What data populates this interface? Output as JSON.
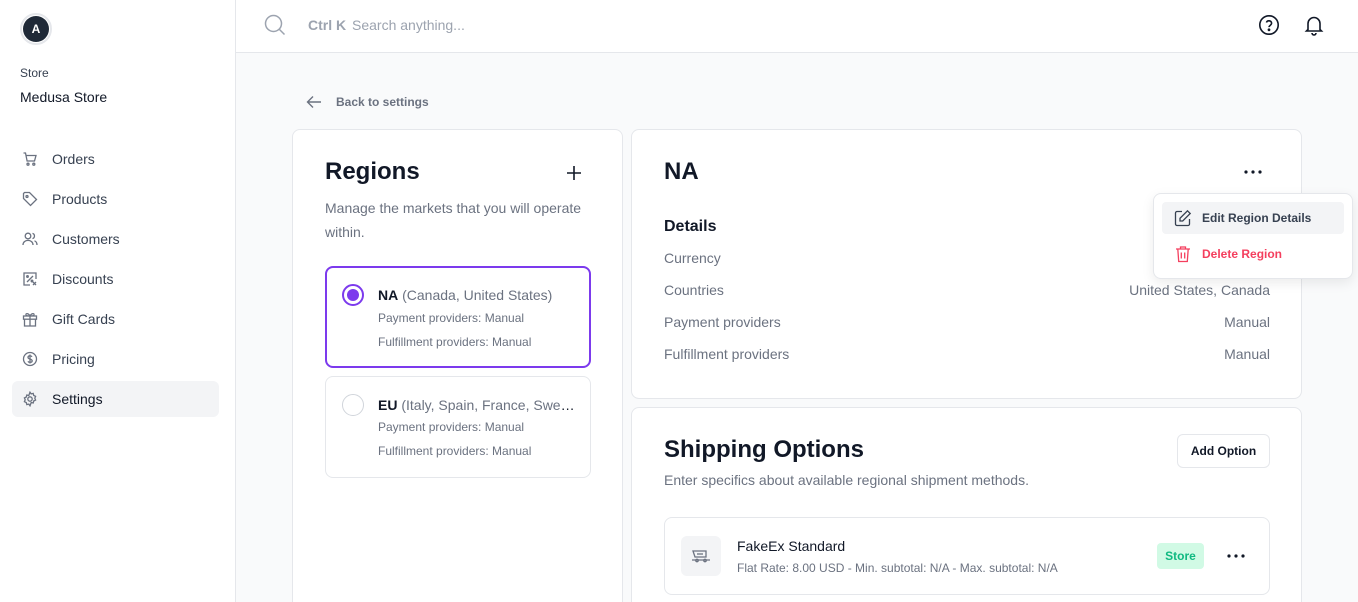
{
  "store": {
    "avatar_letter": "A",
    "label": "Store",
    "name": "Medusa Store"
  },
  "nav": [
    {
      "label": "Orders",
      "icon": "cart-icon"
    },
    {
      "label": "Products",
      "icon": "tag-icon"
    },
    {
      "label": "Customers",
      "icon": "users-icon"
    },
    {
      "label": "Discounts",
      "icon": "discount-icon"
    },
    {
      "label": "Gift Cards",
      "icon": "gift-icon"
    },
    {
      "label": "Pricing",
      "icon": "currency-icon"
    },
    {
      "label": "Settings",
      "icon": "gear-icon",
      "active": true
    }
  ],
  "search": {
    "shortcut": "Ctrl K",
    "placeholder": "Search anything..."
  },
  "back": {
    "label": "Back to settings"
  },
  "regions": {
    "title": "Regions",
    "description": "Manage the markets that you will operate within.",
    "items": [
      {
        "code": "NA",
        "countries": "(Canada, United States)",
        "payment": "Payment providers: Manual",
        "fulfillment": "Fulfillment providers: Manual",
        "selected": true
      },
      {
        "code": "EU",
        "countries": "(Italy, Spain, France, Sweden, Germany, Denmark, United Kingdom)",
        "payment": "Payment providers: Manual",
        "fulfillment": "Fulfillment providers: Manual",
        "selected": false
      }
    ]
  },
  "details": {
    "title": "NA",
    "heading": "Details",
    "rows": [
      {
        "label": "Currency",
        "value": ""
      },
      {
        "label": "Countries",
        "value": "United States, Canada"
      },
      {
        "label": "Payment providers",
        "value": "Manual"
      },
      {
        "label": "Fulfillment providers",
        "value": "Manual"
      }
    ]
  },
  "menu": {
    "edit_label": "Edit Region Details",
    "delete_label": "Delete Region"
  },
  "shipping": {
    "title": "Shipping Options",
    "description": "Enter specifics about available regional shipment methods.",
    "add_label": "Add Option",
    "options": [
      {
        "name": "FakeEx Standard",
        "meta": "Flat Rate: 8.00 USD - Min. subtotal: N/A - Max. subtotal: N/A",
        "badge": "Store"
      }
    ]
  },
  "colors": {
    "accent": "#7c3aed",
    "danger": "#f43f5e",
    "badge_bg": "#d1fae5",
    "badge_text": "#10b981"
  }
}
